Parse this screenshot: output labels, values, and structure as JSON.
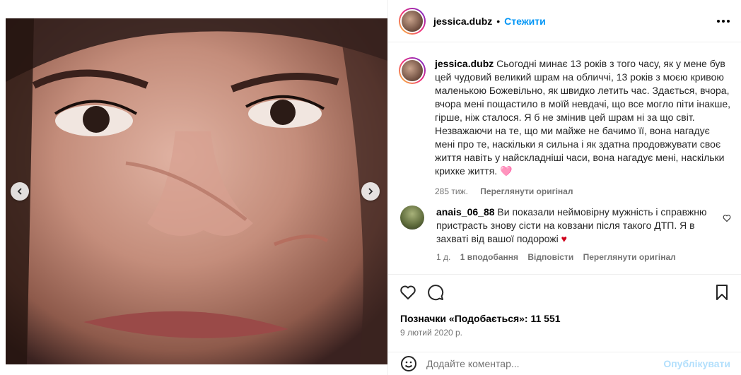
{
  "post": {
    "username": "jessica.dubz",
    "follow_label": "Стежити",
    "dot": "•",
    "caption_text": "Сьогодні минає 13 років з того часу, як у мене був цей чудовий великий шрам на обличчі, 13 років з моєю кривою маленькою Божевільно, як швидко летить час. Здається, вчора, вчора мені пощастило в моїй невдачі, що все могло піти інакше, гірше, ніж сталося. Я б не змінив цей шрам ні за що світ. Незважаючи на те, що ми майже не бачимо її, вона нагадує мені про те, наскільки я сильна і як здатна продовжувати своє життя навіть у найскладніші часи, вона нагадує мені, наскільки крихке життя. 🩷",
    "caption_time": "285 тиж.",
    "see_original": "Переглянути оригінал",
    "likes_text": "Позначки «Подобається»: 11 551",
    "date": "9 лютий 2020 р."
  },
  "comment": {
    "username": "anais_06_88",
    "text": "Ви показали неймовірну мужність і справжню пристрасть знову сісти на ковзани після такого ДТП. Я в захваті від вашої подорожі",
    "heart": "♥",
    "time": "1 д.",
    "likes": "1 вподобання",
    "reply": "Відповісти",
    "see_original": "Переглянути оригінал"
  },
  "add_comment": {
    "placeholder": "Додайте коментар...",
    "post_label": "Опублікувати"
  },
  "icons": {
    "like": "heart-outline-icon",
    "comment": "comment-bubble-icon",
    "save": "bookmark-icon",
    "emoji": "smiley-icon",
    "more": "more-options-icon",
    "prev": "chevron-left-icon",
    "next": "chevron-right-icon"
  },
  "colors": {
    "accent": "#0095f6",
    "muted": "#737373",
    "post_disabled": "#b2dffc",
    "heart": "#d0021b"
  }
}
